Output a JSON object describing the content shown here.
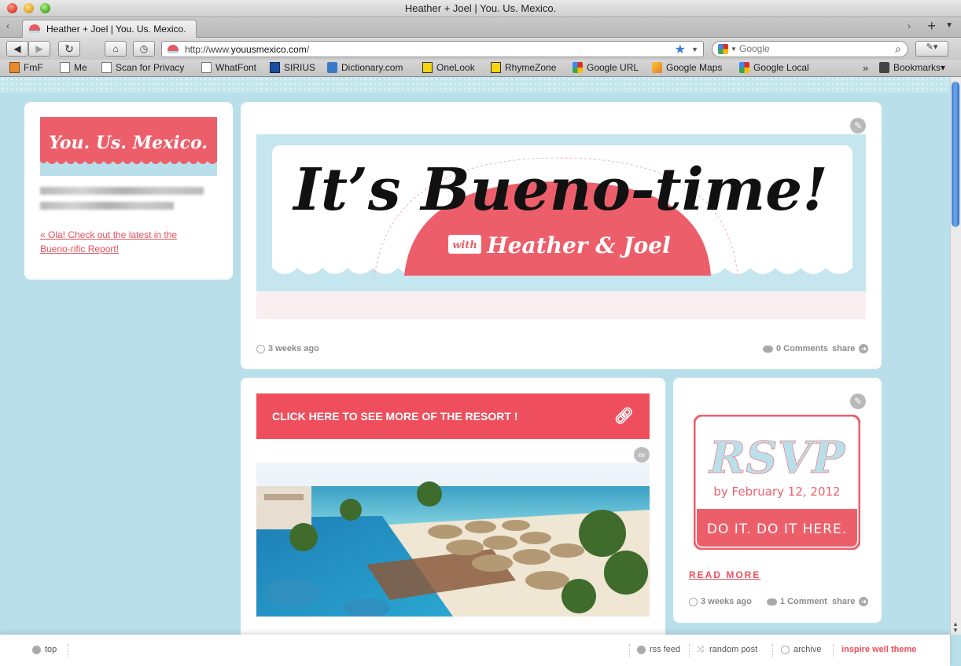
{
  "window": {
    "title": "Heather + Joel | You. Us. Mexico."
  },
  "tabs": [
    {
      "label": "Heather + Joel | You. Us. Mexico."
    }
  ],
  "tab_controls": {
    "new_tab": "+",
    "scroll_left": "‹",
    "scroll_right": "›"
  },
  "navigation": {
    "url_prefix": "http://www.",
    "url_domain": "youusmexico.com",
    "url_suffix": "/",
    "search_placeholder": "Google",
    "back_icon": "back-arrow-icon",
    "forward_icon": "forward-arrow-icon"
  },
  "bookmarks": [
    {
      "label": "FmF",
      "icon": "fmf"
    },
    {
      "label": "Me",
      "icon": "page"
    },
    {
      "label": "Scan for Privacy",
      "icon": "page"
    },
    {
      "label": "WhatFont",
      "icon": "page"
    },
    {
      "label": "SIRIUS",
      "icon": "sirius"
    },
    {
      "label": "Dictionary.com",
      "icon": "dict"
    },
    {
      "label": "OneLook",
      "icon": "yellow"
    },
    {
      "label": "RhymeZone",
      "icon": "yellow"
    },
    {
      "label": "Google URL",
      "icon": "google"
    },
    {
      "label": "Google Maps",
      "icon": "maps"
    },
    {
      "label": "Google Local",
      "icon": "google"
    },
    {
      "label": "Bookmarks",
      "icon": "book"
    }
  ],
  "sidebar": {
    "logo_text": "You. Us. Mexico.",
    "link_text": "« Ola! Check out the latest in the Bueno-rific Report!"
  },
  "hero_post": {
    "headline": "It’s Bueno-time!",
    "with_text": "with",
    "names": "Heather & Joel",
    "timestamp": "3 weeks ago",
    "comments": "0 Comments",
    "share": "share"
  },
  "link_post": {
    "cta": "CLICK HERE TO SEE MORE OF THE RESORT !"
  },
  "rsvp_post": {
    "rsvp_word": "RSVP",
    "by_date": "by February 12, 2012",
    "do_it": "DO IT. DO IT HERE.",
    "read_more": "READ MORE",
    "timestamp": "3 weeks ago",
    "comments": "1 Comment",
    "share": "share"
  },
  "footer": {
    "top": "top",
    "rss": "rss feed",
    "random": "random post",
    "archive": "archive",
    "credit": "inspire well theme"
  },
  "colors": {
    "page_bg": "#b9e0ea",
    "accent": "#ef4f5c",
    "hero_pink": "#ec5f6a"
  }
}
